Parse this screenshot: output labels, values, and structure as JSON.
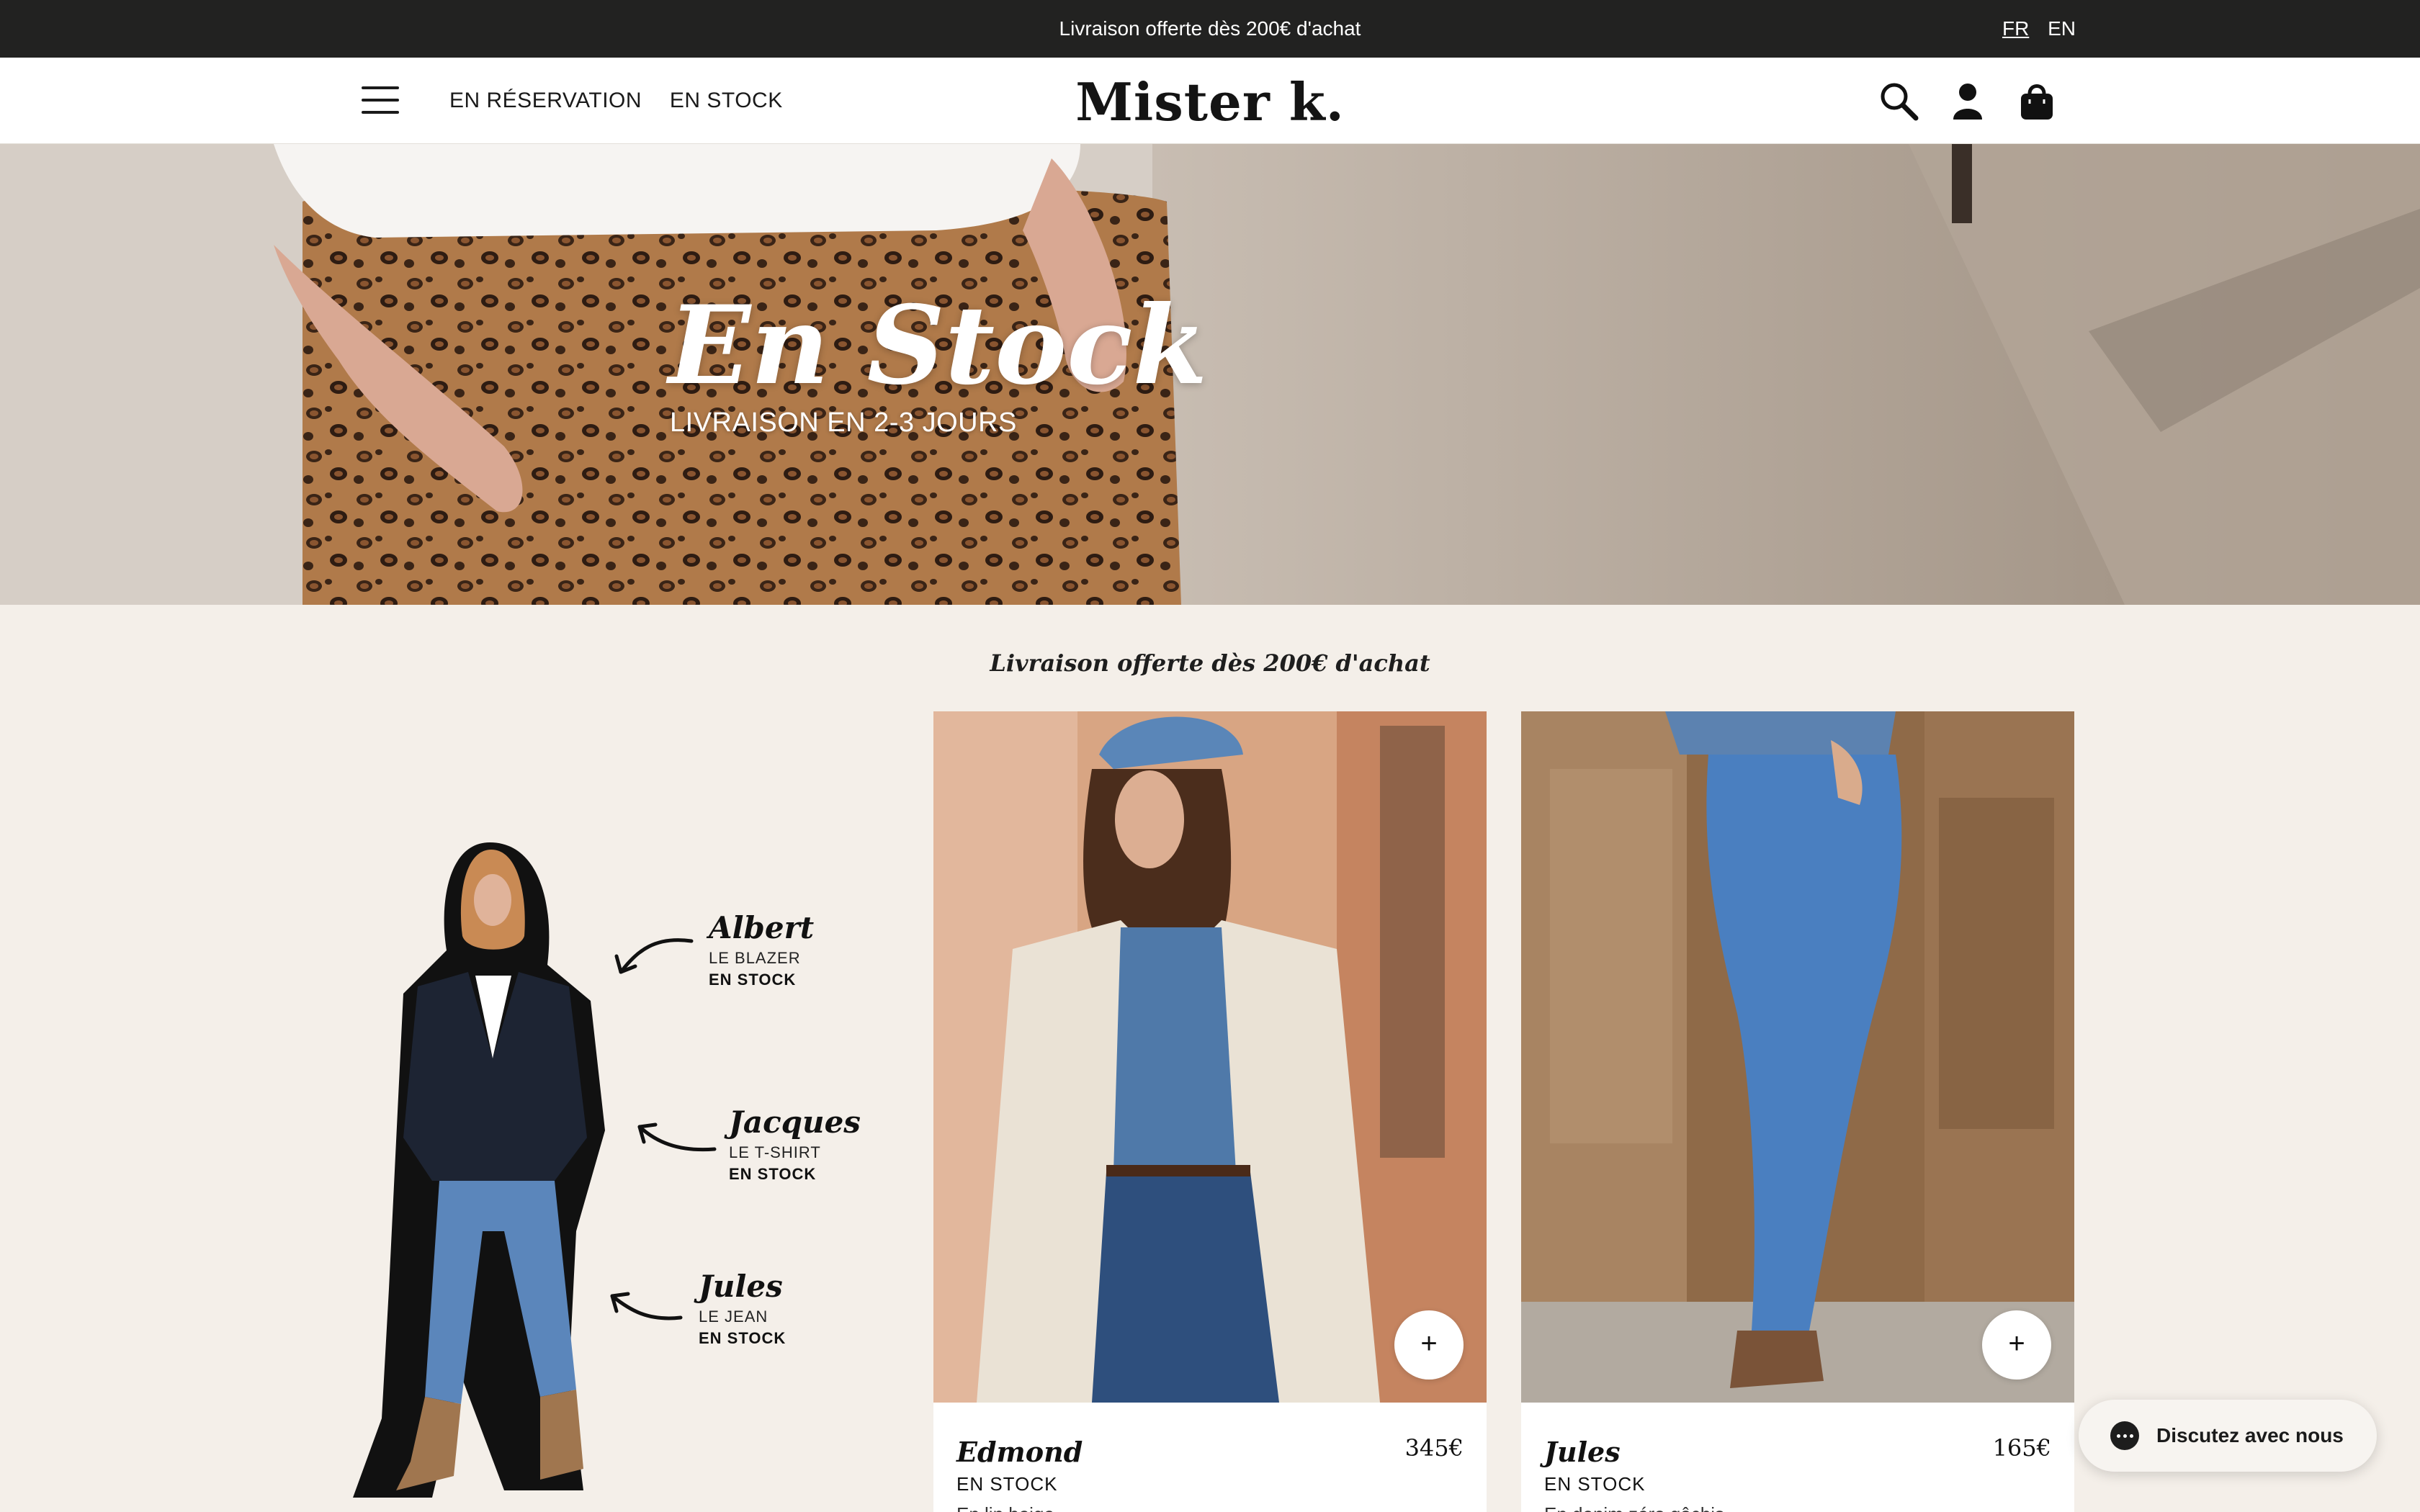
{
  "announcement": {
    "text": "Livraison offerte dès 200€ d'achat"
  },
  "languages": [
    {
      "code": "FR",
      "active": true
    },
    {
      "code": "EN",
      "active": false
    }
  ],
  "header": {
    "nav": [
      "EN RÉSERVATION",
      "EN STOCK"
    ],
    "logo": "Mister k.",
    "icons": [
      "search-icon",
      "account-icon",
      "bag-icon"
    ]
  },
  "hero": {
    "title": "En Stock",
    "subtitle": "LIVRAISON EN 2-3 JOURS"
  },
  "promo": "Livraison offerte dès 200€ d'achat",
  "look": {
    "items": [
      {
        "name": "Albert",
        "type": "LE BLAZER",
        "status": "EN STOCK"
      },
      {
        "name": "Jacques",
        "type": "LE T-SHIRT",
        "status": "EN STOCK"
      },
      {
        "name": "Jules",
        "type": "LE JEAN",
        "status": "EN STOCK"
      }
    ]
  },
  "products": [
    {
      "name": "Edmond",
      "price": "345€",
      "status": "EN STOCK",
      "description": "En lin beige"
    },
    {
      "name": "Jules",
      "price": "165€",
      "status": "EN STOCK",
      "description": "En denim zéro gâchis"
    }
  ],
  "chat": {
    "label": "Discutez avec nous"
  },
  "colors": {
    "topbar": "#222221",
    "background": "#f4efe9",
    "card": "#ffffff",
    "denim": "#3d6fa8"
  }
}
